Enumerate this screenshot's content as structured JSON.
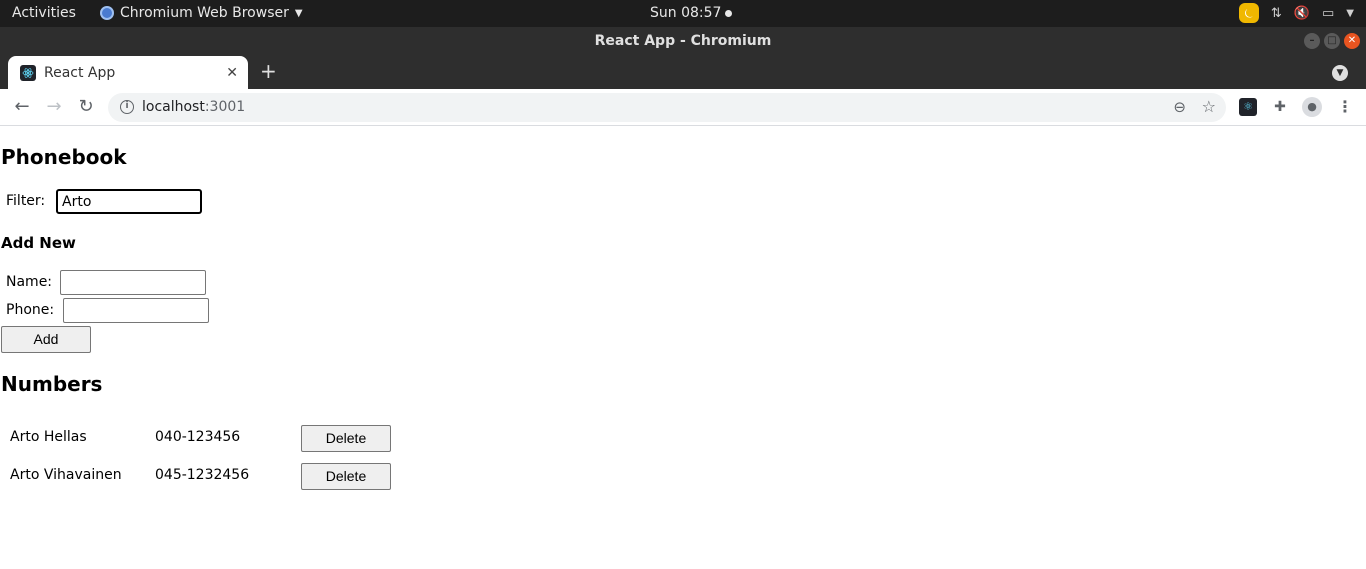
{
  "os": {
    "activities": "Activities",
    "app_menu": "Chromium Web Browser",
    "clock": "Sun 08:57"
  },
  "window": {
    "title": "React App - Chromium"
  },
  "tabs": [
    {
      "title": "React App"
    }
  ],
  "toolbar": {
    "url_host": "localhost",
    "url_port": ":3001"
  },
  "app": {
    "heading": "Phonebook",
    "filter": {
      "label": "Filter:",
      "value": "Arto"
    },
    "add_section": {
      "heading": "Add New",
      "name_label": "Name:",
      "name_value": "",
      "phone_label": "Phone:",
      "phone_value": "",
      "add_button": "Add"
    },
    "numbers": {
      "heading": "Numbers",
      "rows": [
        {
          "name": "Arto Hellas",
          "number": "040-123456",
          "delete_label": "Delete"
        },
        {
          "name": "Arto Vihavainen",
          "number": "045-1232456",
          "delete_label": "Delete"
        }
      ]
    }
  }
}
